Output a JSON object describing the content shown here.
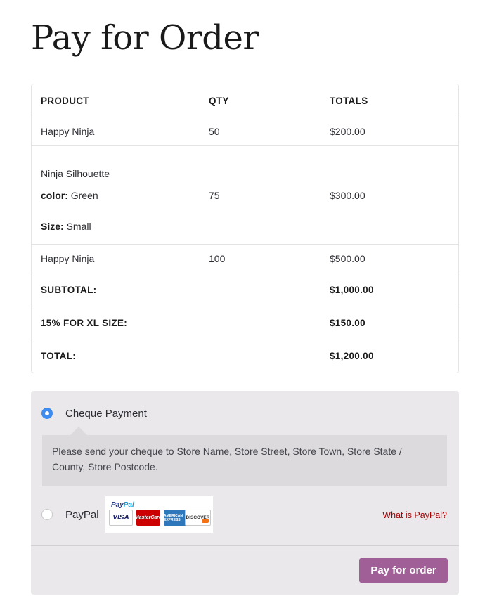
{
  "page": {
    "title": "Pay for Order"
  },
  "table": {
    "headers": {
      "product": "PRODUCT",
      "qty": "QTY",
      "totals": "TOTALS"
    },
    "items": [
      {
        "product": "Happy Ninja",
        "qty": "50",
        "total": "$200.00"
      },
      {
        "product": "Ninja Silhouette",
        "meta": [
          {
            "label": "color:",
            "value": "Green"
          },
          {
            "label": "Size:",
            "value": "Small"
          }
        ],
        "qty": "75",
        "total": "$300.00"
      },
      {
        "product": "Happy Ninja",
        "qty": "100",
        "total": "$500.00"
      }
    ],
    "footer": [
      {
        "label": "SUBTOTAL:",
        "value": "$1,000.00"
      },
      {
        "label": "15% FOR XL SIZE:",
        "value": "$150.00"
      },
      {
        "label": "TOTAL:",
        "value": "$1,200.00"
      }
    ]
  },
  "payment": {
    "methods": [
      {
        "label": "Cheque Payment",
        "selected": true
      },
      {
        "label": "PayPal",
        "selected": false
      }
    ],
    "cheque_description": "Please send your cheque to Store Name, Store Street, Store Town, Store State / County, Store Postcode.",
    "paypal_logo": {
      "pay": "Pay",
      "pal": "Pal"
    },
    "cards": [
      "VISA",
      "MasterCard",
      "AMERICAN EXPRESS",
      "DISCOVER"
    ],
    "what_is_paypal": "What is PayPal?",
    "submit_label": "Pay for order",
    "colors": {
      "button": "#a06097",
      "link": "#a40000",
      "radio_selected": "#3d8cf0",
      "panel": "#eae8ea"
    }
  }
}
